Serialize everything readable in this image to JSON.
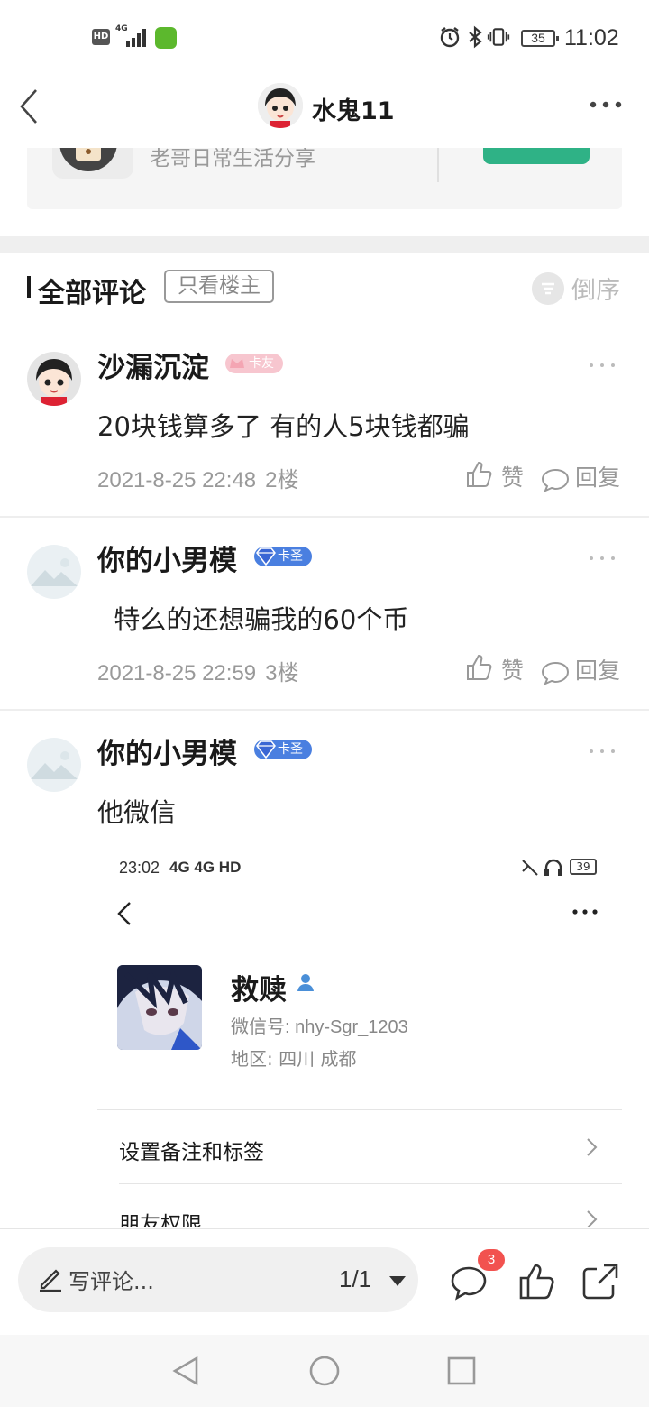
{
  "status_bar": {
    "hd": "HD",
    "network": "4G",
    "battery": "35",
    "time": "11:02"
  },
  "header": {
    "title": "水鬼11",
    "back_icon": "back-arrow-icon",
    "more_icon": "more-dots-icon"
  },
  "top_card": {
    "description": "老哥日常生活分享"
  },
  "comments_section": {
    "title": "全部评论",
    "filter_label": "只看楼主",
    "sort_label": "倒序"
  },
  "comments": [
    {
      "author": "沙漏沉淀",
      "badge": "卡友",
      "text": "20块钱算多了 有的人5块钱都骗",
      "date": "2021-8-25 22:48",
      "floor": "2楼",
      "like_label": "赞",
      "reply_label": "回复"
    },
    {
      "author": "你的小男模",
      "badge": "卡圣",
      "text": "  特么的还想骗我的60个币",
      "date": "2021-8-25 22:59",
      "floor": "3楼",
      "like_label": "赞",
      "reply_label": "回复"
    },
    {
      "author": "你的小男模",
      "badge": "卡圣",
      "text": "他微信"
    }
  ],
  "embedded_screenshot": {
    "time": "23:02",
    "network": "4G 4G HD",
    "battery": "39",
    "contact_name": "救赎",
    "wechat_id": "微信号: nhy-Sgr_1203",
    "region": "地区: 四川  成都",
    "rows": [
      "设置备注和标签",
      "朋友权限"
    ]
  },
  "bottom_bar": {
    "input_placeholder": "写评论...",
    "page_indicator": "1/1",
    "comment_count": "3"
  },
  "colors": {
    "accent_green": "#2fb286",
    "badge_pink": "#f7b8c3",
    "badge_blue": "#4a7fe0",
    "count_red": "#f2524f"
  }
}
